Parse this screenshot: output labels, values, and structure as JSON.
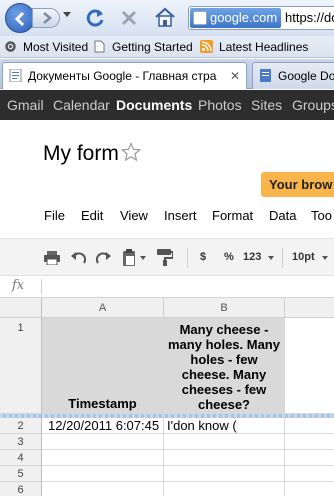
{
  "browser": {
    "url_domain": "google.com",
    "url_text": "https://do",
    "bookmarks": [
      "Most Visited",
      "Getting Started",
      "Latest Headlines"
    ],
    "tabs": [
      {
        "title": "Документы Google - Главная стра",
        "active": true
      },
      {
        "title": "Google Do",
        "active": false
      }
    ]
  },
  "gbar": {
    "items": [
      "Gmail",
      "Calendar",
      "Documents",
      "Photos",
      "Sites",
      "Groups"
    ],
    "active": "Documents"
  },
  "doc": {
    "title": "My form",
    "notice": "Your brow"
  },
  "menu": [
    "File",
    "Edit",
    "View",
    "Insert",
    "Format",
    "Data",
    "Too"
  ],
  "toolbar": {
    "currency": "$",
    "percent": "%",
    "number_format": "123",
    "font_size": "10pt"
  },
  "formula": {
    "icon_label": "fx",
    "value": ""
  },
  "sheet": {
    "columns": [
      "A",
      "B"
    ],
    "rows": [
      "1",
      "2",
      "3",
      "4",
      "5",
      "6"
    ],
    "header_row": [
      "Timestamp",
      "Many cheese - many holes. Many holes - few cheese. Many cheeses - few cheese?"
    ],
    "data_rows": [
      [
        "12/20/2011 6:07:45",
        "I'don know ("
      ]
    ]
  },
  "colors": {
    "gbar_bg": "#2d2d2d",
    "notice_bg": "#f9b44b",
    "header_cell_bg": "#d9d9d9"
  }
}
